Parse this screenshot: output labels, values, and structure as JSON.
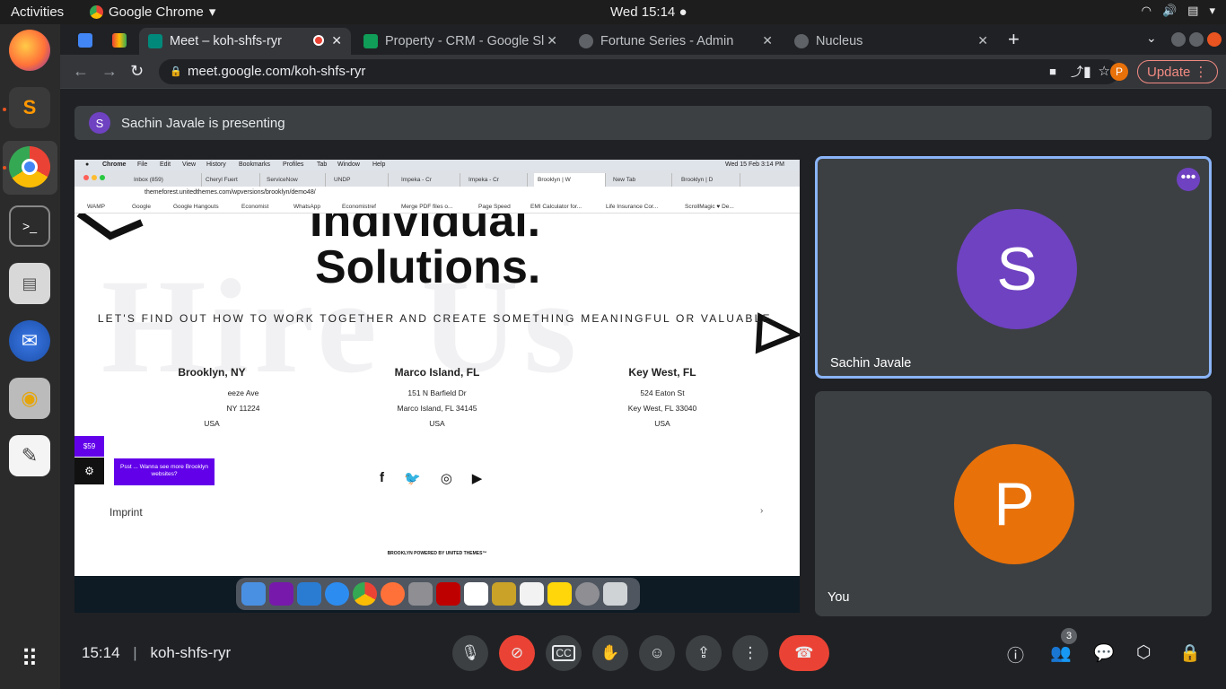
{
  "system": {
    "activities": "Activities",
    "app": "Google Chrome",
    "clock": "Wed 15:14 ●"
  },
  "browser": {
    "tabs": [
      {
        "label": "Meet – koh-shfs-ryr"
      },
      {
        "label": "Property - CRM - Google Sl"
      },
      {
        "label": "Fortune Series - Admin"
      },
      {
        "label": "Nucleus"
      }
    ],
    "url": "meet.google.com/koh-shfs-ryr",
    "update_label": "Update",
    "profile_letter": "P"
  },
  "meet": {
    "presenting": "Sachin Javale is presenting",
    "presenter_initial": "S",
    "participants": [
      {
        "name": "Sachin Javale",
        "initial": "S",
        "color": "#6f42c1"
      },
      {
        "name": "You",
        "initial": "P",
        "color": "#e8710a"
      }
    ],
    "time": "15:14",
    "meeting_code": "koh-shfs-ryr",
    "people_count": "3"
  },
  "shared": {
    "mac_menu": [
      "Chrome",
      "File",
      "Edit",
      "View",
      "History",
      "Bookmarks",
      "Profiles",
      "Tab",
      "Window",
      "Help"
    ],
    "mac_clock": "Wed 15 Feb 3:14 PM",
    "tabs": [
      "Inbox (859)",
      "Cheryl Fuert",
      "ServiceNow",
      "UNDP",
      "Impeka - Cr",
      "Impeka - Cr",
      "Brooklyn | W",
      "New Tab",
      "Brooklyn | D"
    ],
    "url": "themeforest.unitedthemes.com/wpversions/brooklyn/demo48/",
    "bookmarks": [
      "WAMP",
      "Google",
      "Google Hangouts",
      "Economist",
      "WhatsApp",
      "Economistref",
      "Merge PDF files o...",
      "Page Speed",
      "EMI Calculator for...",
      "Life Insurance Cor...",
      "ScrollMagic ♥ De..."
    ],
    "watermark": "Hire Us",
    "heading1": "Individual.",
    "heading2": "Solutions.",
    "tagline": "LET'S FIND OUT HOW TO WORK TOGETHER AND CREATE SOMETHING MEANINGFUL OR VALUABLE.",
    "locations": [
      {
        "title": "Brooklyn, NY",
        "line1": "eeze Ave",
        "line2": "NY 11224",
        "line3": "USA"
      },
      {
        "title": "Marco Island, FL",
        "line1": "151 N Barfield Dr",
        "line2": "Marco Island, FL 34145",
        "line3": "USA"
      },
      {
        "title": "Key West, FL",
        "line1": "524 Eaton St",
        "line2": "Key West, FL 33040",
        "line3": "USA"
      }
    ],
    "imprint": "Imprint",
    "powered": "BROOKLYN POWERED BY UNITED THEMES™",
    "price": "$59",
    "tooltip": "Psst ... Wanna see more Brooklyn websites?"
  }
}
